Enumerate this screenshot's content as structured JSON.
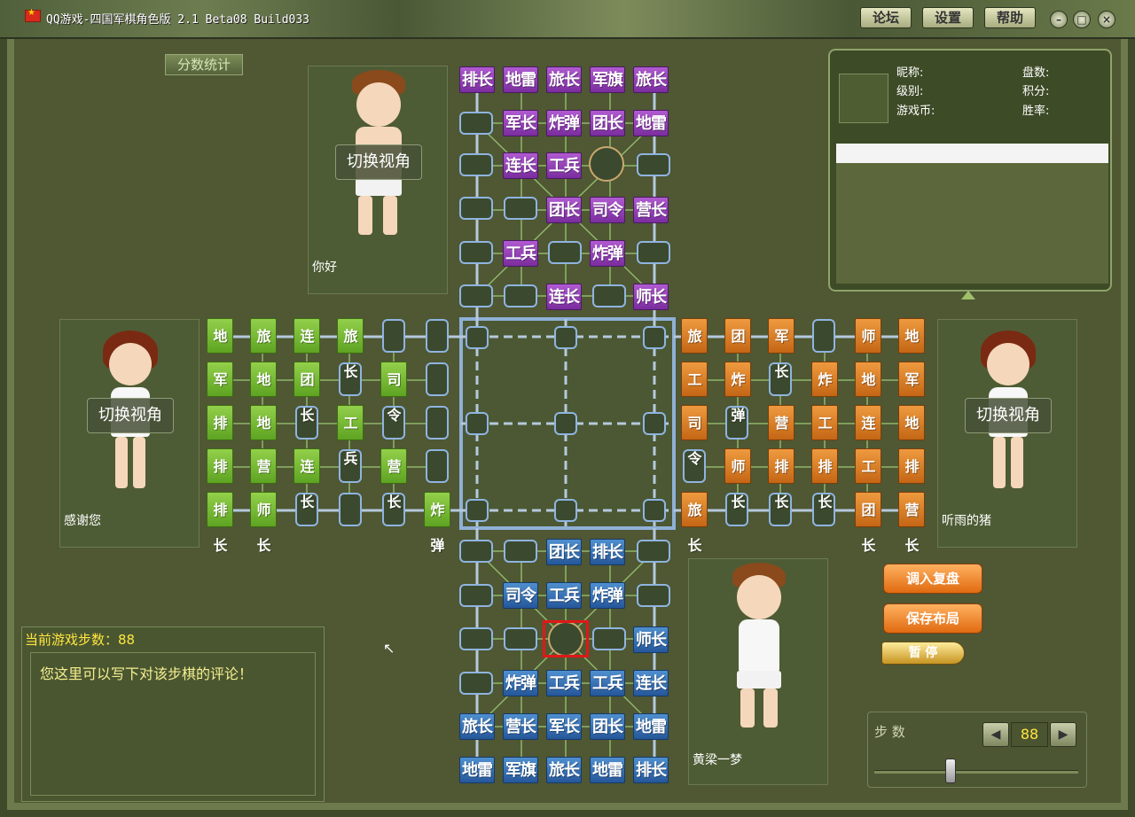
{
  "window": {
    "title": "QQ游戏-四国军棋角色版 2.1 Beta08 Build033",
    "buttons": [
      "论坛",
      "设置",
      "帮助"
    ],
    "controls": [
      "minimize",
      "restore",
      "close"
    ]
  },
  "score_tab": "分数统计",
  "players": {
    "top": {
      "name": "你好",
      "switch": "切换视角"
    },
    "left": {
      "name": "感谢您",
      "switch": "切换视角"
    },
    "right": {
      "name": "听雨的猪",
      "switch": "切换视角"
    },
    "bottom": {
      "name": "黄梁一梦"
    }
  },
  "info": {
    "nickname_label": "昵称:",
    "level_label": "级别:",
    "coins_label": "游戏币:",
    "games_label": "盘数:",
    "points_label": "积分:",
    "winrate_label": "胜率:"
  },
  "board": {
    "top_purple": [
      [
        "排长",
        "地雷",
        "旅长",
        "军旗",
        "旅长"
      ],
      [
        "",
        "军长",
        "炸弹",
        "团长",
        "地雷"
      ],
      [
        "",
        "连长",
        "工兵",
        "",
        ""
      ],
      [
        "",
        "",
        "团长",
        "司令",
        "营长"
      ],
      [
        "",
        "工兵",
        "",
        "炸弹",
        ""
      ],
      [
        "",
        "",
        "连长",
        "",
        "师长"
      ]
    ],
    "bottom_blue": [
      [
        "",
        "",
        "团长",
        "排长",
        ""
      ],
      [
        "",
        "司令",
        "工兵",
        "炸弹",
        ""
      ],
      [
        "",
        "",
        "",
        "",
        "师长"
      ],
      [
        "",
        "炸弹",
        "工兵",
        "工兵",
        "连长"
      ],
      [
        "旅长",
        "营长",
        "军长",
        "团长",
        "地雷"
      ],
      [
        "地雷",
        "军旗",
        "旅长",
        "地雷",
        "排长"
      ]
    ],
    "left_green_cols": [
      [
        "地雷",
        "军旗",
        "排长",
        "排长",
        "排长"
      ],
      [
        "旅长",
        "地雷",
        "地雷",
        "营长",
        "师长"
      ],
      [
        "连长",
        "团长",
        "",
        "连长",
        ""
      ],
      [
        "旅长",
        "",
        "工兵",
        "",
        ""
      ],
      [
        "",
        "司令",
        "",
        "营长",
        ""
      ],
      [
        "",
        "",
        "",
        "",
        "炸弹"
      ]
    ],
    "right_orange_cols": [
      [
        "旅长",
        "工兵",
        "司令",
        "",
        "旅长"
      ],
      [
        "团长",
        "炸弹",
        "",
        "师长",
        ""
      ],
      [
        "军长",
        "",
        "营长",
        "排长",
        ""
      ],
      [
        "",
        "炸弹",
        "工兵",
        "排长",
        ""
      ],
      [
        "师长",
        "地雷",
        "连长",
        "工兵",
        "团长"
      ],
      [
        "地雷",
        "军旗",
        "地雷",
        "排长",
        "营长"
      ]
    ]
  },
  "actions": {
    "load_replay": "调入复盘",
    "save_layout": "保存布局",
    "pause": "暂 停"
  },
  "steps": {
    "label": "步 数",
    "value": "88",
    "slider_fraction": 0.36
  },
  "comment": {
    "header": "当前游戏步数：88",
    "text": "您这里可以写下对该步棋的评论！"
  },
  "colors": {
    "purple": "#8a3ab0",
    "blue": "#2f6bb0",
    "green": "#6fb52c",
    "orange": "#d97820",
    "selection": "#e01818"
  }
}
